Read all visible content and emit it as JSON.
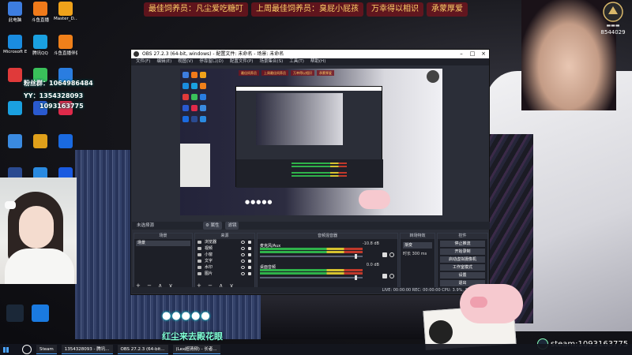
{
  "banner": {
    "items": [
      "最佳饲养员：凡尘爱吃糖叮",
      "上周最佳饲养员：臭屁小屁孩",
      "万幸得以相识",
      "承蒙厚爱"
    ]
  },
  "logo": {
    "counter": "8544029"
  },
  "desktop": {
    "icons": [
      {
        "label": "此电脑",
        "color": "#3d7de0"
      },
      {
        "label": "斗鱼直播",
        "color": "#f07a1a"
      },
      {
        "label": "Master_D...",
        "color": "#f0a21a"
      },
      {
        "label": "Microsoft Edge",
        "color": "#1a8ce0"
      },
      {
        "label": "腾讯QQ",
        "color": "#1aa0e0"
      },
      {
        "label": "斗鱼直播伴侣",
        "color": "#f0801a"
      },
      {
        "label": "",
        "color": "#e03a3a"
      },
      {
        "label": "",
        "color": "#3ac05a"
      },
      {
        "label": "",
        "color": "#2a7de0"
      },
      {
        "label": "",
        "color": "#1aa0e0"
      },
      {
        "label": "",
        "color": "#2a5ad0"
      },
      {
        "label": "",
        "color": "#e02a4a"
      },
      {
        "label": "",
        "color": "#3a8ae0"
      },
      {
        "label": "",
        "color": "#e0a01a"
      },
      {
        "label": "",
        "color": "#1a6ae0"
      },
      {
        "label": "",
        "color": "#2a4a90"
      },
      {
        "label": "",
        "color": "#2a8ae0"
      },
      {
        "label": "",
        "color": "#1a5ae0"
      }
    ],
    "bottom_icons": [
      {
        "label": "",
        "color": "#1b2838"
      },
      {
        "label": "",
        "color": "#1a7ae0"
      }
    ]
  },
  "left_info": {
    "lines": [
      "粉丝群：1064986484",
      "YY：1354328093",
      "1093163775"
    ]
  },
  "obs": {
    "title": "OBS 27.2.3 (64-bit, windows) - 配置文件: 未命名 - 场景: 未命名",
    "menu": [
      "文件(F)",
      "编辑(E)",
      "视图(V)",
      "停靠窗口(D)",
      "配置文件(P)",
      "场景集合(S)",
      "工具(T)",
      "帮助(H)"
    ],
    "preview": {
      "banner": [
        "最佳饲养员",
        "上周最佳饲养员",
        "万幸得以相识",
        "承蒙厚爱"
      ],
      "dots": "●●●●●"
    },
    "dock_header": {
      "left": "未选择源",
      "buttons": [
        "⚙ 属性",
        "滤镜"
      ]
    },
    "panels": {
      "scenes": {
        "title": "场景",
        "items": [
          "场景"
        ]
      },
      "sources": {
        "title": "来源",
        "items": [
          "浏览器",
          "视频",
          "小窗",
          "文字",
          "水印",
          "图片"
        ]
      },
      "mixer": {
        "title": "音频混音器",
        "channels": [
          {
            "name": "麦克风/Aux",
            "db": "-10.8 dB"
          },
          {
            "name": "桌面音频",
            "db": "0.0 dB"
          }
        ]
      },
      "transitions": {
        "title": "转场特效",
        "select": "渐变",
        "duration_label": "时长",
        "duration": "300 ms"
      },
      "controls": {
        "title": "控件",
        "buttons": [
          "停止推流",
          "开始录制",
          "启动虚拟摄像机",
          "工作室模式",
          "设置",
          "退出"
        ]
      }
    },
    "footer_symbols": "+ − ∧ ∨",
    "status": "LIVE: 00:00:00   REC: 00:00:00   CPU: 3.9%, 30.00 fps"
  },
  "overlay": {
    "dots": "●●●●●",
    "ticker": "红尘来去殿花眼"
  },
  "steam": {
    "id": "steam:1093163775"
  },
  "taskbar": {
    "tasks": [
      "Steam",
      "1354328093 - 腾讯...",
      "OBS 27.2.3 (64-bit...",
      "(Lex超清频) - 长者..."
    ]
  }
}
